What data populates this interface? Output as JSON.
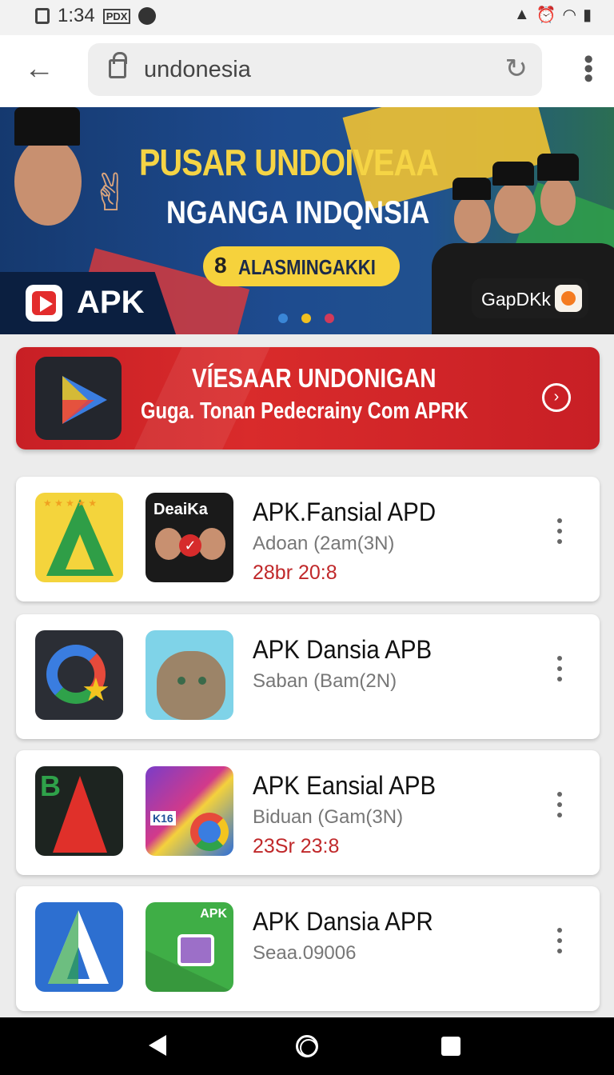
{
  "status_bar": {
    "time": "1:34",
    "icon_a": "photo-icon",
    "icon_b": "PDX",
    "icon_c": "messenger-icon",
    "right_signal": "signal-icon",
    "right_alarm": "alarm-icon",
    "right_wifi": "wifi-icon",
    "right_battery": "battery-icon"
  },
  "browser": {
    "url": "undonesia",
    "menu_glyph": "⋮"
  },
  "banner": {
    "title_line1": "PUSAR UNDOIVEAA",
    "title_line2": "NGANGA INDQNSIA",
    "pill_text": "ALASMINGAKKI",
    "apk_label": "APK",
    "brand_label": "GapDKk",
    "dot_colors": [
      "#3a86d6",
      "#f0c020",
      "#d13a5a"
    ]
  },
  "promo": {
    "title": "VÍESAAR UNDONIGAN",
    "subtitle": "Guga. Tonan Pedecrainy Com APRK"
  },
  "apps": [
    {
      "title": "APK.Fansial APD",
      "subtitle": "Adoan (2am(3N)",
      "date": "28br 20:8",
      "icon2_text": "DeaiKa"
    },
    {
      "title": "APK Dansia APB",
      "subtitle": "Saban (Bam(2N)",
      "date": ""
    },
    {
      "title": "APK Eansial APB",
      "subtitle": "Biduan (Gam(3N)",
      "date": "23Sr 23:8",
      "icon1_text": "B",
      "icon2_text": "K16"
    },
    {
      "title": "APK Dansia APR",
      "subtitle": "Seaa.09006",
      "date": "",
      "icon2_text": "APK"
    }
  ]
}
